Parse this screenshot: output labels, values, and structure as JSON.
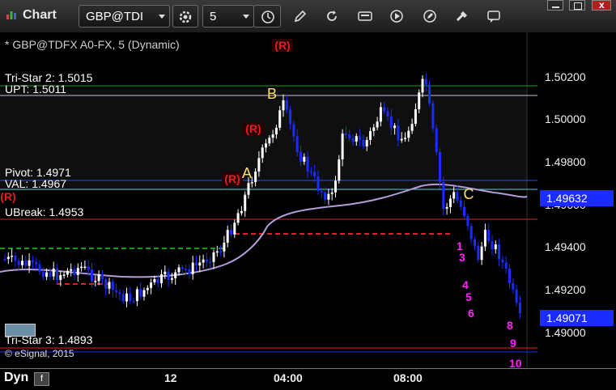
{
  "window": {
    "title": "Chart"
  },
  "toolbar": {
    "symbol": "GBP@TDI",
    "interval": "5"
  },
  "chart": {
    "series_label": "* GBP@TDFX A0-FX, 5 (Dynamic)",
    "r_marker": "(R)",
    "copyright": "© eSignal, 2015",
    "levels": {
      "tristar2": "Tri-Star 2: 1.5015",
      "upt": "UPT: 1.5011",
      "pivot": "Pivot: 1.4971",
      "val": "VAL: 1.4967",
      "ubreak": "UBreak: 1.4953",
      "tristar3": "Tri-Star 3: 1.4893"
    },
    "points": {
      "a": "A",
      "b": "B",
      "c": "C"
    },
    "price_axis": [
      "1.50200",
      "1.50000",
      "1.49800",
      "1.49600",
      "1.49400",
      "1.49200",
      "1.49000"
    ],
    "price_badges": {
      "ma": "1.49632",
      "last": "1.49071"
    },
    "time_axis": [
      "12",
      "04:00",
      "08:00"
    ],
    "footer": {
      "mode": "Dyn"
    },
    "count_labels": [
      "1",
      "3",
      "4",
      "5",
      "6",
      "8",
      "9",
      "10"
    ],
    "colors": {
      "up_bar": "#ffffff",
      "down_bar": "#1a2cff",
      "ma": "#b39ddb",
      "red": "#e02020",
      "green": "#1a9e1a",
      "magenta": "#ff22ff",
      "yellow": "#ffe066",
      "badge": "#1a2cff"
    }
  }
}
